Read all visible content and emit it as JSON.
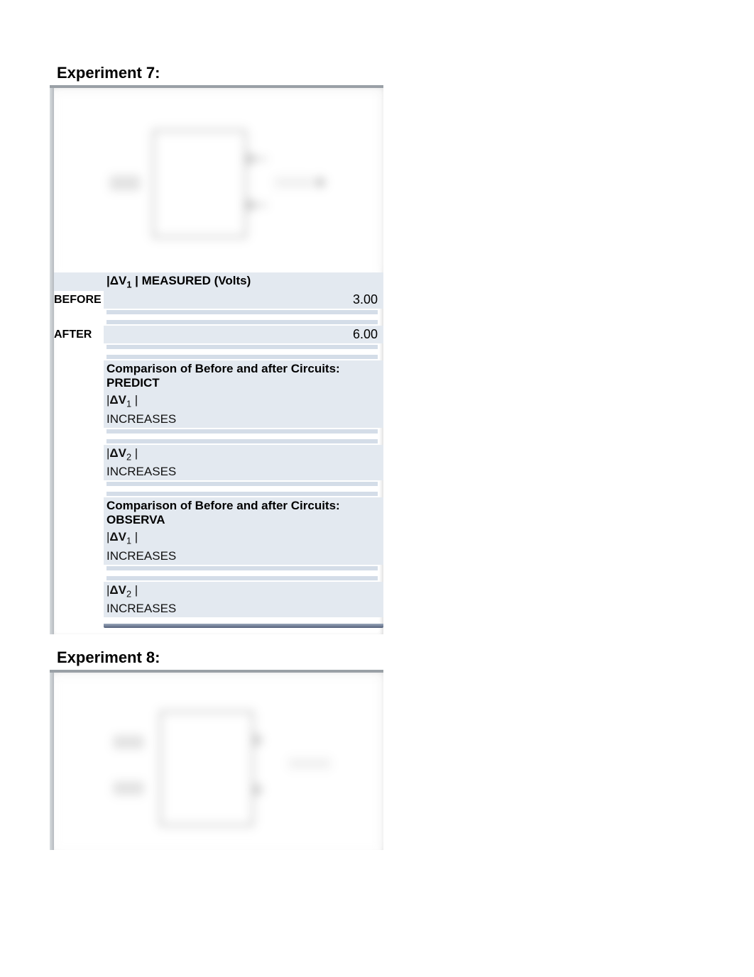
{
  "experiments": [
    {
      "title": "Experiment 7:",
      "measured_header_prefix": "|",
      "measured_header_dv": "ΔV",
      "measured_header_sub": "1",
      "measured_header_suffix": " | MEASURED (Volts)",
      "rows": {
        "before_label": "BEFORE",
        "before_value": "3.00",
        "after_label": "AFTER",
        "after_value": "6.00"
      },
      "predict_header": "Comparison of Before and after Circuits:  PREDICT",
      "predict": {
        "dv1_label_prefix": "|",
        "dv1_label_dv": "ΔV",
        "dv1_label_sub": "1",
        "dv1_label_suffix": " |",
        "dv1_value": "INCREASES",
        "dv2_label_prefix": "|",
        "dv2_label_dv": "ΔV",
        "dv2_label_sub": "2",
        "dv2_label_suffix": " |",
        "dv2_value": "INCREASES"
      },
      "observa_header": "Comparison of Before and after Circuits:  OBSERVA",
      "observa": {
        "dv1_label_prefix": "|",
        "dv1_label_dv": "ΔV",
        "dv1_label_sub": "1",
        "dv1_label_suffix": " |",
        "dv1_value": "INCREASES",
        "dv2_label_prefix": "|",
        "dv2_label_dv": "ΔV",
        "dv2_label_sub": "2",
        "dv2_label_suffix": " |",
        "dv2_value": "INCREASES"
      }
    },
    {
      "title": "Experiment 8:"
    }
  ]
}
